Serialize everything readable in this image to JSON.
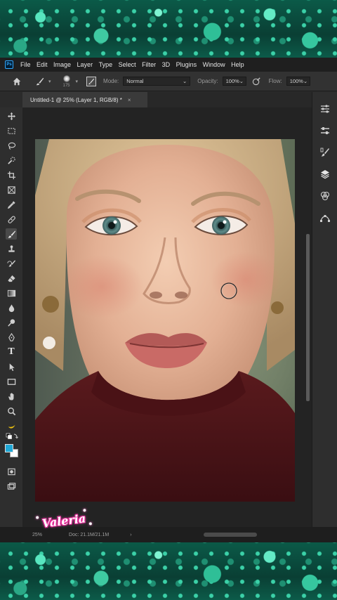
{
  "app": {
    "logo_text": "Ps",
    "menu": [
      "File",
      "Edit",
      "Image",
      "Layer",
      "Type",
      "Select",
      "Filter",
      "3D",
      "Plugins",
      "Window",
      "Help"
    ]
  },
  "options_bar": {
    "brush_size": "175",
    "mode_label": "Mode:",
    "mode_value": "Normal",
    "opacity_label": "Opacity:",
    "opacity_value": "100%",
    "flow_label": "Flow:",
    "flow_value": "100%"
  },
  "document": {
    "tab_title": "Untitled-1 @ 25% (Layer 1, RGB/8) *",
    "close_glyph": "×"
  },
  "tools": [
    "move-tool",
    "marquee-tool",
    "lasso-tool",
    "quick-selection-tool",
    "crop-tool",
    "frame-tool",
    "eyedropper-tool",
    "spot-healing-tool",
    "brush-tool",
    "clone-stamp-tool",
    "history-brush-tool",
    "eraser-tool",
    "gradient-tool",
    "blur-tool",
    "dodge-tool",
    "pen-tool",
    "type-tool",
    "path-selection-tool",
    "rectangle-tool",
    "hand-tool",
    "zoom-tool",
    "more-tools"
  ],
  "type_tool_glyph": "T",
  "colors": {
    "foreground": "#1fa8d6",
    "background": "#ffffff",
    "accent": "#31a8ff"
  },
  "right_panel": [
    "adjustments-icon",
    "properties-icon",
    "brush-settings-icon",
    "layers-icon",
    "channels-icon",
    "paths-icon"
  ],
  "status": {
    "zoom": "25%",
    "doc_size": "Doc: 21.1M/21.1M",
    "arrow": "›"
  },
  "watermark": "Valeria"
}
